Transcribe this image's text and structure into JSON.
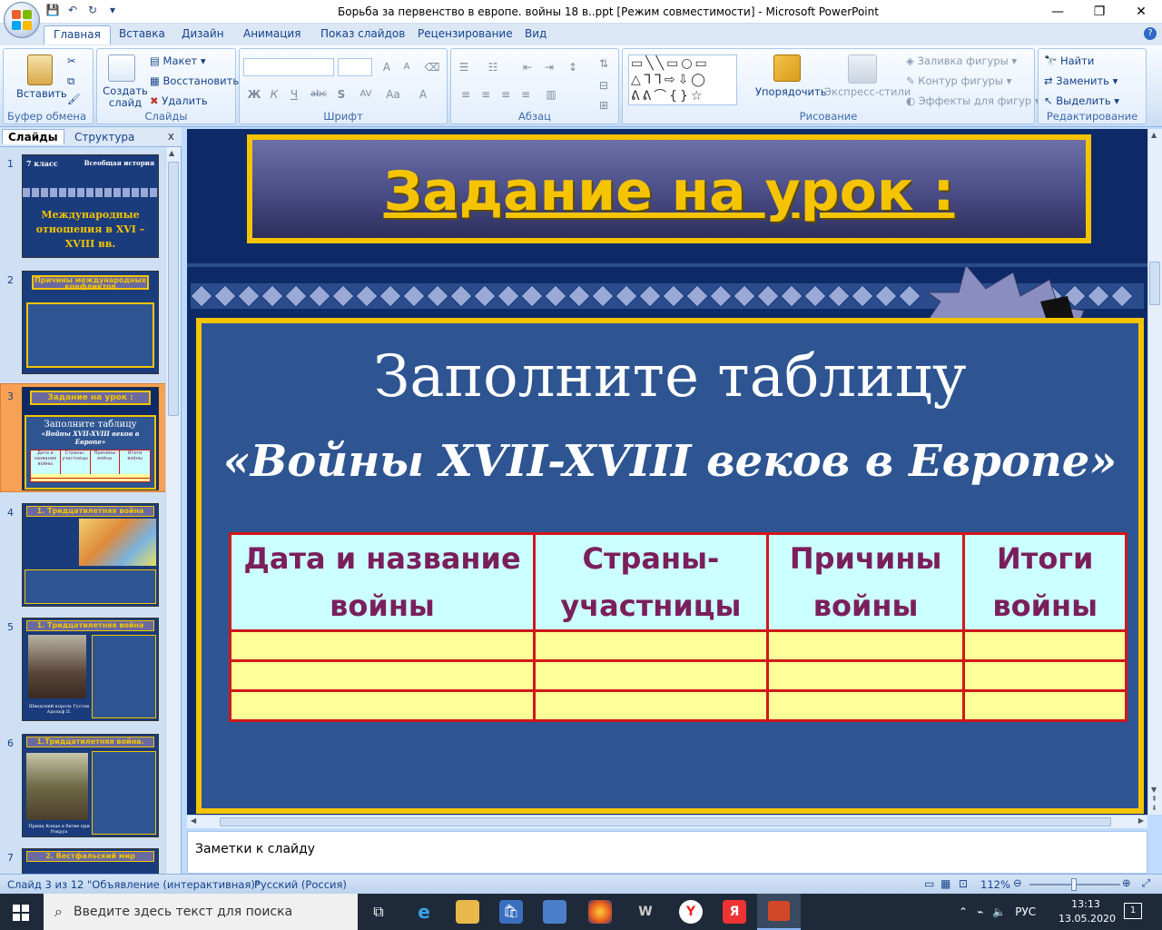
{
  "window": {
    "title": "Борьба за первенство в европе. войны 18 в..ppt [Режим совместимости] - Microsoft PowerPoint",
    "minimize": "—",
    "restore": "❐",
    "close": "✕"
  },
  "qat": {
    "save": "💾",
    "undo": "↶",
    "redo": "↻",
    "more": "▾"
  },
  "tabs": [
    "Главная",
    "Вставка",
    "Дизайн",
    "Анимация",
    "Показ слайдов",
    "Рецензирование",
    "Вид"
  ],
  "help": "?",
  "ribbon": {
    "clipboard": {
      "paste": "Вставить",
      "label": "Буфер обмена"
    },
    "slides": {
      "new_slide": "Создать слайд",
      "layout": "Макет",
      "reset": "Восстановить",
      "delete": "Удалить",
      "label": "Слайды"
    },
    "font": {
      "label": "Шрифт",
      "bold": "Ж",
      "italic": "К",
      "underline": "Ч",
      "strike": "abc",
      "shadow": "S",
      "spacing": "AV",
      "case": "Aa",
      "color": "A",
      "grow": "A",
      "shrink": "A"
    },
    "paragraph": {
      "label": "Абзац"
    },
    "drawing": {
      "arrange": "Упорядочить",
      "quick_styles": "Экспресс-стили",
      "fill": "Заливка фигуры",
      "outline": "Контур фигуры",
      "effects": "Эффекты для фигур",
      "label": "Рисование"
    },
    "editing": {
      "find": "Найти",
      "replace": "Заменить",
      "select": "Выделить",
      "label": "Редактирование"
    }
  },
  "pane": {
    "tab_slides": "Слайды",
    "tab_outline": "Структура",
    "close": "x",
    "thumbnails": [
      {
        "num": "1",
        "top_left": "7 класс",
        "top_right": "Всеобщая история",
        "title": "Международные отношения в XVI – XVIII вв."
      },
      {
        "num": "2",
        "title": "Причины международных конфликтов"
      },
      {
        "num": "3",
        "title": "Задание на урок :",
        "sub": "Заполните таблицу",
        "sub2": "«Войны XVII-XVIII веков в Европе»",
        "cols": [
          "Дата и название войны",
          "Страны-участницы",
          "Причины войны",
          "Итоги войны"
        ]
      },
      {
        "num": "4",
        "title": "1. Тридцатилетняя война"
      },
      {
        "num": "5",
        "title": "1. Тридцатилетняя война",
        "caption": "Шведский король Густав Адольф II."
      },
      {
        "num": "6",
        "title": "1.Тридцатилетняя война.",
        "caption": "Принц Конде в битве при Рокруа"
      },
      {
        "num": "7",
        "title": "2. Вестфальский мир"
      }
    ]
  },
  "slide": {
    "title": "Задание на урок :",
    "heading": "Заполните таблицу",
    "subheading": "«Войны XVII-XVIII веков в Европе»",
    "table": {
      "headers": [
        "Дата и название войны",
        "Страны-участницы",
        "Причины войны",
        "Итоги войны"
      ],
      "rows": [
        [
          "",
          "",
          "",
          ""
        ],
        [
          "",
          "",
          "",
          ""
        ],
        [
          "",
          "",
          "",
          ""
        ]
      ]
    }
  },
  "notes": "Заметки к слайду",
  "status": {
    "slide": "Слайд 3 из 12",
    "theme": "\"Объявление (интерактивная)\"",
    "lang": "Русский (Россия)",
    "zoom": "112%"
  },
  "taskbar": {
    "search": "Введите здесь текст для поиска",
    "lang": "РУС",
    "time": "13:13",
    "date": "13.05.2020",
    "notif": "1"
  },
  "colors": {
    "slide_bg": "#2e5592",
    "title_text": "#f5c400",
    "table_header_bg": "#ccffff",
    "table_header_text": "#7a1f5c",
    "table_cell_bg": "#ffff99",
    "table_border": "#d01818",
    "frame": "#f0c400"
  }
}
